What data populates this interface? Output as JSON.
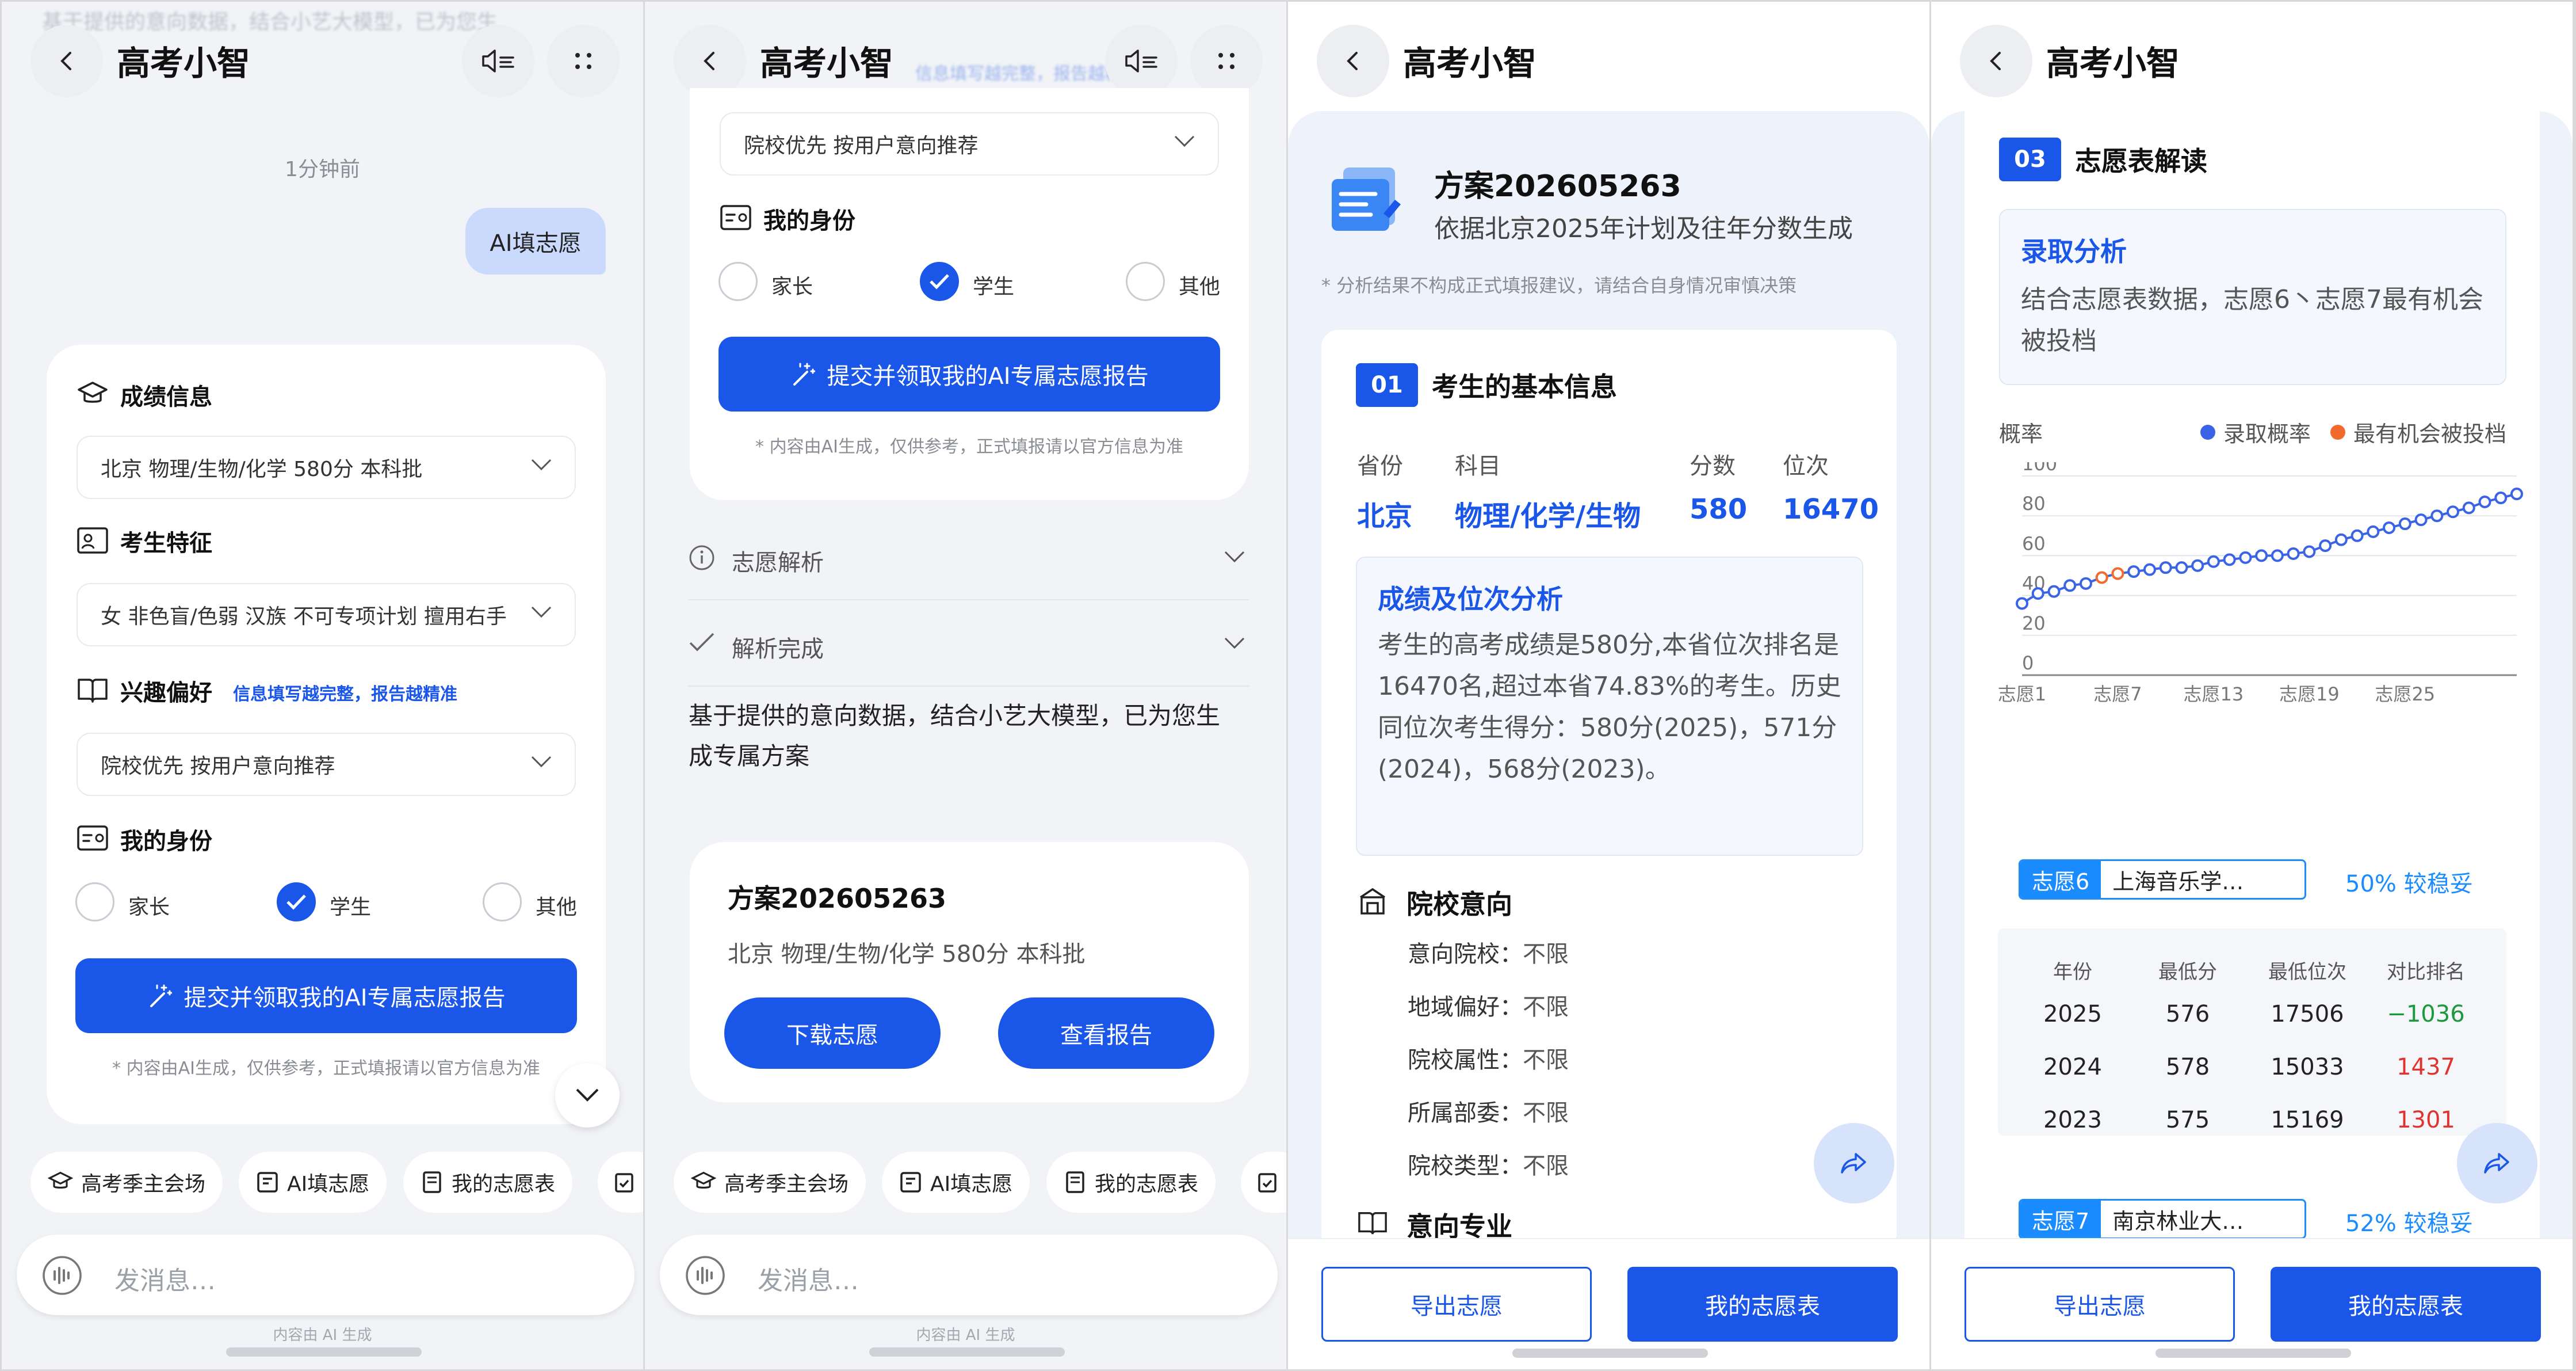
{
  "header_title": "高考小智",
  "panel1": {
    "faded_top": "基于提供的意向数据，结合小艺大模型，已为您生",
    "timestamp": "1分钟前",
    "user_bubble": "AI填志愿",
    "score_title": "成绩信息",
    "score_value": "北京 物理/生物/化学 580分 本科批",
    "feature_title": "考生特征",
    "feature_value": "女 非色盲/色弱 汉族 不可专项计划 擅用右手",
    "interest_title": "兴趣偏好",
    "interest_hint": "信息填写越完整，报告越精准",
    "interest_value": "院校优先 按用户意向推荐",
    "identity_title": "我的身份",
    "identity_options": [
      "家长",
      "学生",
      "其他"
    ],
    "submit_label": "提交并领取我的AI专属志愿报告",
    "disclaimer": "* 内容由AI生成，仅供参考，正式填报请以官方信息为准"
  },
  "panel2": {
    "faded_top": "信息填写越完整，报告越精准",
    "interest_value": "院校优先 按用户意向推荐",
    "identity_title": "我的身份",
    "identity_options": [
      "家长",
      "学生",
      "其他"
    ],
    "submit_label": "提交并领取我的AI专属志愿报告",
    "disclaimer": "* 内容由AI生成，仅供参考，正式填报请以官方信息为准",
    "fold1": "志愿解析",
    "fold2": "解析完成",
    "result_text": "基于提供的意向数据，结合小艺大模型，已为您生成专属方案",
    "plan_title": "方案202605263",
    "plan_sub": "北京 物理/生物/化学 580分 本科批",
    "download_label": "下载志愿",
    "view_label": "查看报告"
  },
  "shortcuts": [
    "高考季主会场",
    "AI填志愿",
    "我的志愿表"
  ],
  "message_placeholder": "发消息…",
  "ai_footnote": "内容由 AI 生成",
  "panel3": {
    "plan_title": "方案202605263",
    "plan_sub": "依据北京2025年计划及往年分数生成",
    "note": "* 分析结果不构成正式填报建议，请结合自身情况审慎决策",
    "section_num": "01",
    "section_title": "考生的基本信息",
    "info_headers": [
      "省份",
      "科目",
      "分数",
      "位次"
    ],
    "info_values": [
      "北京",
      "物理/化学/生物",
      "580",
      "16470"
    ],
    "analysis_title": "成绩及位次分析",
    "analysis_text": "考生的高考成绩是580分,本省位次排名是16470名,超过本省74.83%的考生。历史同位次考生得分：580分(2025)，571分(2024)，568分(2023)。",
    "intent_title": "院校意向",
    "intent_rows": [
      {
        "k": "意向院校：",
        "v": "不限"
      },
      {
        "k": "地域偏好：",
        "v": "不限"
      },
      {
        "k": "院校属性：",
        "v": "不限"
      },
      {
        "k": "所属部委：",
        "v": "不限"
      },
      {
        "k": "院校类型：",
        "v": "不限"
      }
    ],
    "major_title": "意向专业",
    "export_label": "导出志愿",
    "mytable_label": "我的志愿表"
  },
  "panel4": {
    "section_num": "03",
    "section_title": "志愿表解读",
    "analysis_title": "录取分析",
    "analysis_text": "结合志愿表数据，志愿6丶志愿7最有机会被投档",
    "chart_ylabel": "概率",
    "legend": [
      "录取概率",
      "最有机会被投档"
    ],
    "colors": {
      "series": "#3b63e6",
      "highlight": "#f26b2d",
      "accent": "#1a56e8",
      "up": "#1a9a3a",
      "down": "#e0332f"
    },
    "choice6": {
      "tag": "志愿6",
      "name": "上海音乐学…",
      "prob": "50% 较稳妥"
    },
    "table_headers": [
      "年份",
      "最低分",
      "最低位次",
      "对比排名"
    ],
    "table_rows": [
      [
        "2025",
        "576",
        "17506",
        "−1036"
      ],
      [
        "2024",
        "578",
        "15033",
        "1437"
      ],
      [
        "2023",
        "575",
        "15169",
        "1301"
      ]
    ],
    "choice7": {
      "tag": "志愿7",
      "name": "南京林业大…",
      "prob": "52% 较稳妥"
    },
    "export_label": "导出志愿",
    "mytable_label": "我的志愿表"
  },
  "chart_data": {
    "type": "line",
    "title": "",
    "ylabel": "概率",
    "xlabel": "",
    "ylim": [
      0,
      100
    ],
    "yticks": [
      0,
      20,
      40,
      60,
      80,
      100
    ],
    "xticks": [
      "志愿1",
      "志愿7",
      "志愿13",
      "志愿19",
      "志愿25"
    ],
    "x": [
      1,
      2,
      3,
      4,
      5,
      6,
      7,
      8,
      9,
      10,
      11,
      12,
      13,
      14,
      15,
      16,
      17,
      18,
      19,
      20,
      21,
      22,
      23,
      24,
      25,
      26,
      27,
      28,
      29,
      30,
      31,
      32
    ],
    "series": [
      {
        "name": "录取概率",
        "values": [
          36,
          41,
          42,
          45,
          46,
          49,
          51,
          52,
          53,
          54,
          54,
          55,
          57,
          58,
          59,
          60,
          60,
          61,
          62,
          65,
          68,
          70,
          72,
          74,
          76,
          78,
          80,
          82,
          84,
          87,
          89,
          91
        ]
      }
    ],
    "highlight": {
      "name": "最有机会被投档",
      "x": [
        6,
        7
      ]
    },
    "grid": true,
    "legend_position": "top-right"
  }
}
